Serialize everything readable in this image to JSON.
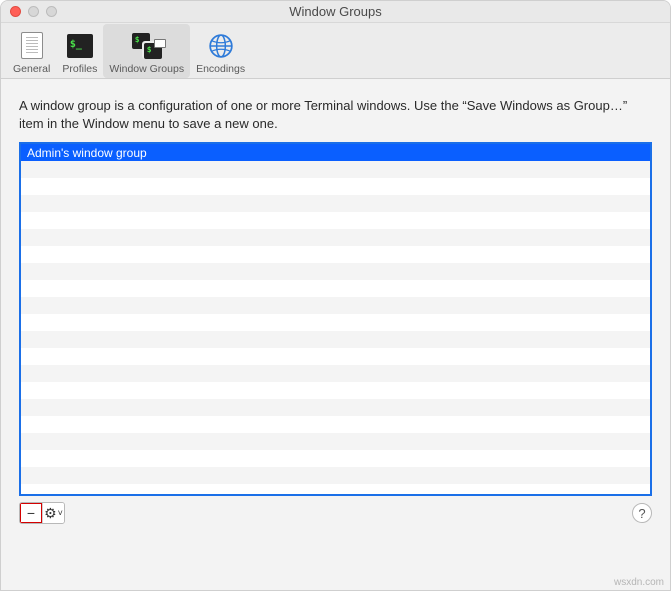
{
  "window": {
    "title": "Window Groups"
  },
  "toolbar": {
    "items": [
      {
        "label": "General"
      },
      {
        "label": "Profiles"
      },
      {
        "label": "Window Groups"
      },
      {
        "label": "Encodings"
      }
    ]
  },
  "description": "A window group is a configuration of one or more Terminal windows. Use the “Save Windows as Group…” item in the Window menu to save a new one.",
  "list": {
    "items": [
      {
        "name": "Admin's window group",
        "selected": true
      }
    ],
    "visible_rows": 20
  },
  "buttons": {
    "remove_symbol": "−",
    "gear_symbol": "⚙",
    "chevron_symbol": "˅",
    "help_symbol": "?"
  },
  "watermark": "wsxdn.com"
}
